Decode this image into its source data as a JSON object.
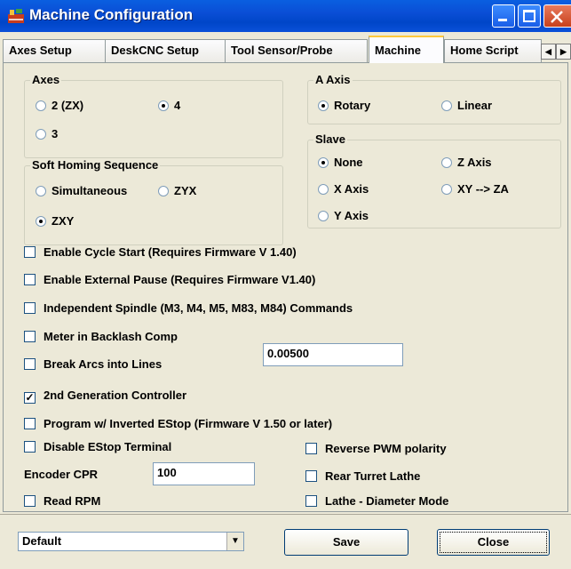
{
  "window": {
    "title": "Machine Configuration"
  },
  "tabs": [
    {
      "label": "Axes Setup"
    },
    {
      "label": "DeskCNC Setup"
    },
    {
      "label": "Tool Sensor/Probe"
    },
    {
      "label": "Machine"
    },
    {
      "label": "Home Script"
    }
  ],
  "axes": {
    "label": "Axes",
    "options": [
      "2 (ZX)",
      "4",
      "3"
    ],
    "selected": "4"
  },
  "a_axis": {
    "label": "A Axis",
    "options": [
      "Rotary",
      "Linear"
    ],
    "selected": "Rotary"
  },
  "soft_homing": {
    "label": "Soft Homing Sequence",
    "options": [
      "Simultaneous",
      "ZYX",
      "ZXY"
    ],
    "selected": "ZXY"
  },
  "slave": {
    "label": "Slave",
    "options": [
      "None",
      "Z Axis",
      "X Axis",
      "XY --> ZA",
      "Y Axis"
    ],
    "selected": "None"
  },
  "checks": [
    {
      "label": "Enable Cycle Start (Requires Firmware V 1.40)",
      "checked": false
    },
    {
      "label": "Enable External Pause (Requires Firmware V1.40)",
      "checked": false
    },
    {
      "label": "Independent Spindle (M3, M4, M5, M83, M84) Commands",
      "checked": false
    },
    {
      "label": "Meter in Backlash Comp",
      "checked": false
    },
    {
      "label": "Break Arcs into Lines",
      "checked": false
    },
    {
      "label": "2nd Generation Controller",
      "checked": true
    },
    {
      "label": "Program w/ Inverted EStop (Firmware V 1.50 or later)",
      "checked": false
    },
    {
      "label": "Disable EStop Terminal",
      "checked": false
    },
    {
      "label": "Read RPM",
      "checked": false
    },
    {
      "label": "Reverse PWM polarity",
      "checked": false
    },
    {
      "label": "Rear Turret Lathe",
      "checked": false
    },
    {
      "label": "Lathe - Diameter  Mode",
      "checked": false
    }
  ],
  "arc_value": "0.00500",
  "encoder": {
    "label": "Encoder CPR",
    "value": "100"
  },
  "profile": {
    "selected": "Default"
  },
  "buttons": {
    "save": "Save",
    "close": "Close"
  }
}
